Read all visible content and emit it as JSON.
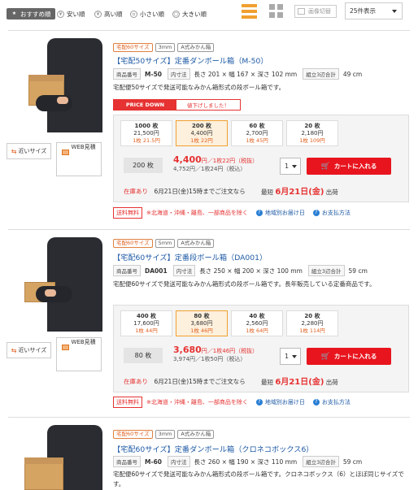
{
  "sort": [
    {
      "label": "おすすめ順",
      "icon": "star-icon",
      "active": true
    },
    {
      "label": "安い順",
      "icon": "yen-icon"
    },
    {
      "label": "高い順",
      "icon": "yen-icon"
    },
    {
      "label": "小さい順",
      "icon": "size-icon"
    },
    {
      "label": "大きい順",
      "icon": "size-icon"
    }
  ],
  "view": {
    "image_switch": "画像切替",
    "per_page": "25件表示"
  },
  "common": {
    "near_label": "近いサイズ",
    "web_label": "WEB見積",
    "spec_code": "商品番号",
    "spec_inner": "内寸法",
    "spec_assembled": "組立3辺合計",
    "cart": "カートに入れる",
    "in_stock": "在庫あり",
    "earliest": "最短",
    "ship_suffix": "出荷",
    "free_ship": "送料無料",
    "free_note": "※北海道・沖縄・離島、一部商品を除く",
    "link1": "地域別お届け日",
    "link2": "お支払方法"
  },
  "products": [
    {
      "tags": [
        "宅配60サイズ",
        "3mm",
        "A式みかん箱"
      ],
      "title": "【宅配50サイズ】定番ダンボール箱（M-50）",
      "code": "M-50",
      "inner": "長さ 201 × 幅 167 × 深さ 102 mm",
      "assembled": "49 cm",
      "desc": "宅配便50サイズで発送可能なみかん箱形式の段ボール箱です。",
      "price_down": "PRICE DOWN",
      "price_down_note": "値下げしました！",
      "tiers": [
        {
          "qty": "1000 枚",
          "price": "21,500円",
          "unit": "1枚 21.5円"
        },
        {
          "qty": "200 枚",
          "price": "4,400円",
          "unit": "1枚 22円"
        },
        {
          "qty": "60 枚",
          "price": "2,700円",
          "unit": "1枚 45円"
        },
        {
          "qty": "20 枚",
          "price": "2,180円",
          "unit": "1枚 109円"
        }
      ],
      "selected_qty": "200 枚",
      "price_main": "4,400",
      "price_main_suffix": "円／1枚22円（税抜）",
      "price_tax": "4,752円／1枚24円（税込）",
      "qty_select": "1",
      "ship_text": "6月21日(金)15時までご注文なら",
      "ship_date": "6月21日",
      "ship_day": "(金)"
    },
    {
      "tags": [
        "宅配60サイズ",
        "5mm",
        "A式みかん箱"
      ],
      "title": "【宅配60サイズ】定番段ボール箱（DA001）",
      "code": "DA001",
      "inner": "長さ 250 × 幅 200 × 深さ 100 mm",
      "assembled": "59 cm",
      "desc": "宅配便60サイズで発送可能なみかん箱形式の段ボール箱です。長年販売している定番商品です。",
      "tiers": [
        {
          "qty": "400 枚",
          "price": "17,600円",
          "unit": "1枚 44円"
        },
        {
          "qty": "80 枚",
          "price": "3,680円",
          "unit": "1枚 46円"
        },
        {
          "qty": "40 枚",
          "price": "2,560円",
          "unit": "1枚 64円"
        },
        {
          "qty": "20 枚",
          "price": "2,280円",
          "unit": "1枚 114円"
        }
      ],
      "selected_qty": "80 枚",
      "price_main": "3,680",
      "price_main_suffix": "円／1枚46円（税抜）",
      "price_tax": "3,974円／1枚50円（税込）",
      "qty_select": "1",
      "ship_text": "6月21日(金)15時までご注文なら",
      "ship_date": "6月21日",
      "ship_day": "(金)"
    },
    {
      "tags": [
        "宅配60サイズ",
        "3mm",
        "A式みかん箱"
      ],
      "title": "【宅配60サイズ】定番ダンボール箱（クロネコボックス6）",
      "code": "M-60",
      "inner": "長さ 260 × 幅 190 × 深さ 110 mm",
      "assembled": "59 cm",
      "desc": "宅配便60サイズで発送可能なみかん箱形式の段ボール箱です。クロネコボックス（6）とほぼ同じサイズです。"
    }
  ],
  "colors": {
    "accent": "#e8151e",
    "link": "#1e5aa6",
    "highlight": "#f0a030"
  }
}
